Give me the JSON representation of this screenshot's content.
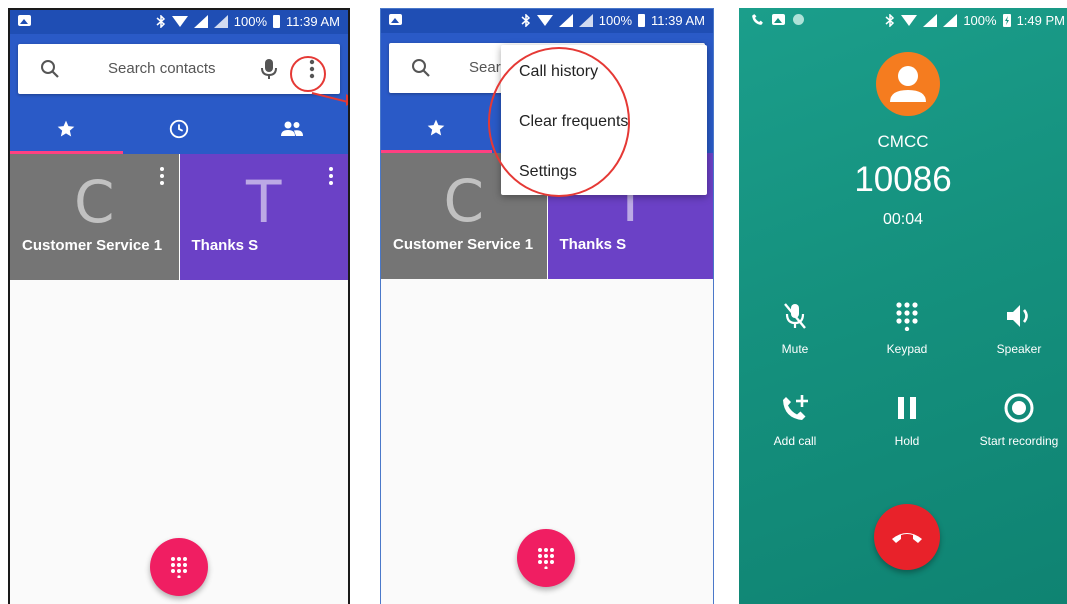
{
  "colors": {
    "status_bar": "#1f4eb4",
    "header": "#2a5ac7",
    "tab_indicator": "#ff4081",
    "tile_grey": "#757575",
    "tile_purple": "#6b41c6",
    "fab": "#f01e62",
    "annotation_red": "#e53935",
    "call_bg": "#15917e",
    "end_call": "#e8222a",
    "avatar": "#f57c1f"
  },
  "status_bar": {
    "battery": "100%",
    "time": "11:39 AM"
  },
  "search": {
    "placeholder": "Search contacts",
    "partial_placeholder": "Searc"
  },
  "tabs": [
    {
      "icon": "star-icon",
      "label": "Speed dial"
    },
    {
      "icon": "clock-icon",
      "label": "Recents"
    },
    {
      "icon": "people-icon",
      "label": "Contacts"
    }
  ],
  "favorites": [
    {
      "letter": "C",
      "name": "Customer Service 1"
    },
    {
      "letter": "T",
      "name": "Thanks S"
    }
  ],
  "overflow_menu": {
    "items": [
      "Call history",
      "Clear frequents",
      "Settings"
    ]
  },
  "call_screen": {
    "status_bar": {
      "battery": "100%",
      "time": "1:49 PM"
    },
    "carrier": "CMCC",
    "number": "10086",
    "timer": "00:04",
    "controls": [
      {
        "icon": "mic-off-icon",
        "label": "Mute"
      },
      {
        "icon": "dialpad-icon",
        "label": "Keypad"
      },
      {
        "icon": "speaker-icon",
        "label": "Speaker"
      },
      {
        "icon": "add-call-icon",
        "label": "Add call"
      },
      {
        "icon": "pause-icon",
        "label": "Hold"
      },
      {
        "icon": "record-icon",
        "label": "Start recording"
      }
    ]
  }
}
